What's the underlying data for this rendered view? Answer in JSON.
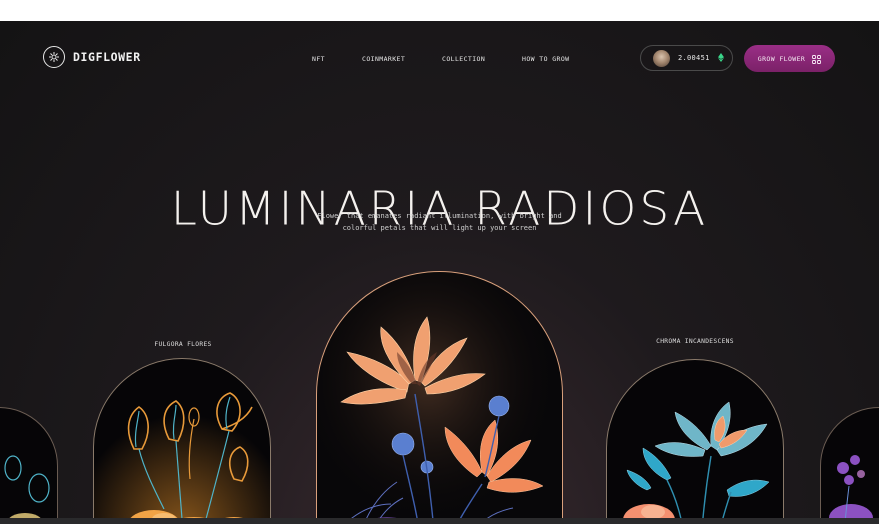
{
  "brand": {
    "name": "DIGFLOWER"
  },
  "nav": {
    "items": [
      "NFT",
      "COINMARKET",
      "COLLECTION",
      "HOW TO GROW"
    ]
  },
  "wallet": {
    "amount": "2.00451",
    "currency_icon": "ethereum-icon"
  },
  "cta": {
    "label": "GROW FLOWER",
    "icon": "grid-icon"
  },
  "hero": {
    "title": "LUMINARIA RADIOSA",
    "subtitle_line1": "Flower that emanates radiant illumination, with bright and",
    "subtitle_line2": "colorful petals that will light up your screen"
  },
  "cards": [
    {
      "label": "FULGORA FLORES",
      "palette": [
        "#e89a3a",
        "#4fb3c8"
      ]
    },
    {
      "label": "",
      "palette": [
        "#f2b27a",
        "#5a7fd0"
      ]
    },
    {
      "label": "CHROMA INCANDESCENS",
      "palette": [
        "#2fa7c9",
        "#f09a6b"
      ]
    }
  ],
  "colors": {
    "accent": "#8e2a7c",
    "background": "#181617",
    "card_border": "#d9a07c",
    "eth_green": "#3ad68a"
  }
}
